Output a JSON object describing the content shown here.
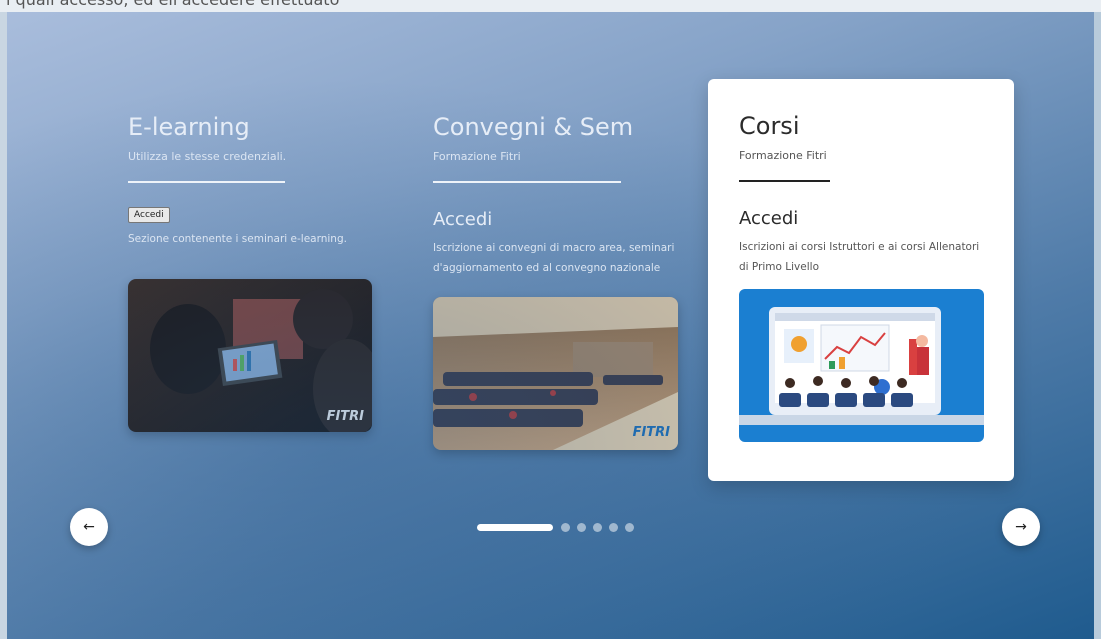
{
  "top_strip_text": "i quali accesso, ed ell'accedere effettuato",
  "cards": [
    {
      "title": "E-learning",
      "subtitle": "Utilizza le stesse credenziali.",
      "button_label": "Accedi",
      "description": "Sezione contenente i seminari e-learning."
    },
    {
      "title": "Convegni & Sem",
      "subtitle": "Formazione Fitri",
      "heading": "Accedi",
      "description": "Iscrizione ai convegni di macro area, seminari d'aggiornamento ed al convegno nazionale"
    },
    {
      "title": "Corsi",
      "subtitle": "Formazione Fitri",
      "heading": "Accedi",
      "description": "Iscrizioni ai corsi Istruttori e ai corsi Allenatori di Primo Livello"
    }
  ],
  "nav": {
    "prev_icon": "arrow-left",
    "next_icon": "arrow-right"
  },
  "pagination": {
    "total": 6,
    "current": 1
  },
  "logo_text": "FITRI",
  "colors": {
    "accent": "#ffffff",
    "card_bg": "#ffffff",
    "stage_dark": "#1f5b8e"
  }
}
